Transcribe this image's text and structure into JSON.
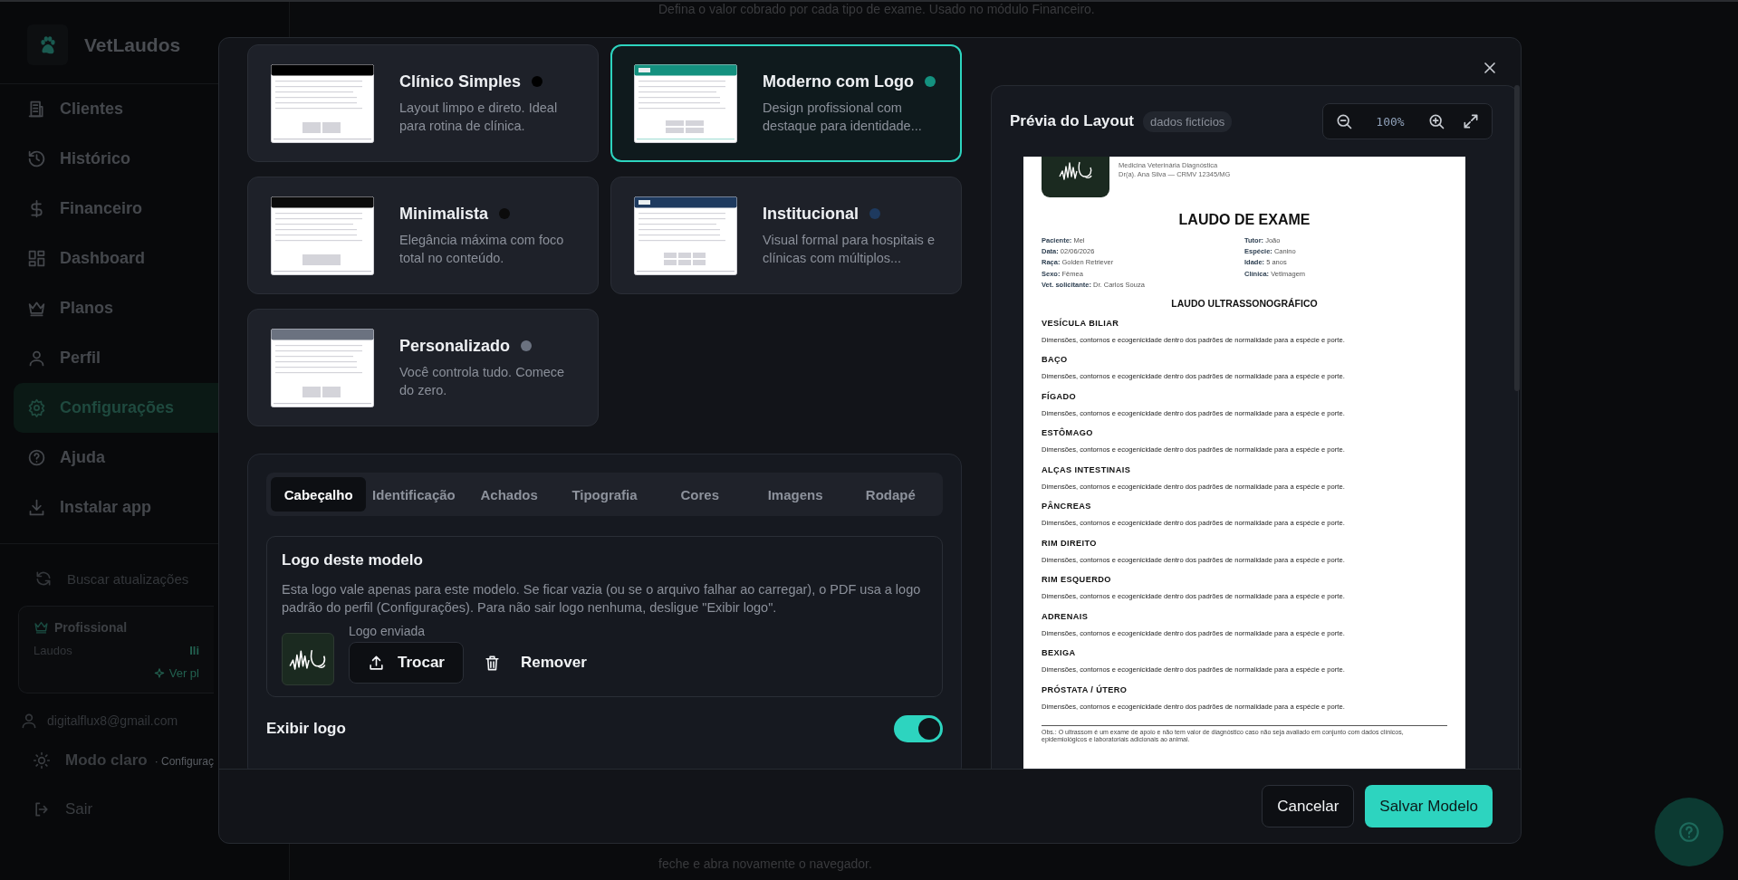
{
  "background": {
    "intro_text": "Defina o valor cobrado por cada tipo de exame. Usado no módulo Financeiro.",
    "footer_text": "feche e abra novamente o navegador."
  },
  "sidebar": {
    "brand": "VetLaudos",
    "items": [
      {
        "label": "Clientes",
        "selected": false
      },
      {
        "label": "Histórico",
        "selected": false
      },
      {
        "label": "Financeiro",
        "selected": false
      },
      {
        "label": "Dashboard",
        "selected": false
      },
      {
        "label": "Planos",
        "selected": false
      },
      {
        "label": "Perfil",
        "selected": false
      },
      {
        "label": "Configurações",
        "selected": true
      },
      {
        "label": "Ajuda",
        "selected": false
      },
      {
        "label": "Instalar app",
        "selected": false
      }
    ],
    "update_button": "Buscar atualizações",
    "plan": {
      "name": "Profissional",
      "usage_label": "Laudos",
      "usage_value": "Ili",
      "link": "Ver pl"
    },
    "email": "digitalflux8@gmail.com",
    "theme": {
      "label": "Modo claro",
      "hint": "· Configuraç"
    },
    "logout": "Sair"
  },
  "modal": {
    "templates": [
      {
        "name": "Clínico Simples",
        "description": "Layout limpo e direto. Ideal para rotina de clínica.",
        "color": "#000000",
        "kind": "simple",
        "selected": false
      },
      {
        "name": "Moderno com Logo",
        "description": "Design profissional com destaque para identidade...",
        "color": "#14917f",
        "kind": "modern",
        "selected": true
      },
      {
        "name": "Minimalista",
        "description": "Elegância máxima com foco total no conteúdo.",
        "color": "#0b0b0b",
        "kind": "minimal",
        "selected": false
      },
      {
        "name": "Institucional",
        "description": "Visual formal para hospitais e clínicas com múltiplos...",
        "color": "#1e3a5f",
        "kind": "institutional",
        "selected": false
      },
      {
        "name": "Personalizado",
        "description": "Você controla tudo. Comece do zero.",
        "color": "#6b7280",
        "kind": "custom",
        "selected": false
      }
    ],
    "editor": {
      "tabs": [
        {
          "label": "Cabeçalho",
          "selected": true
        },
        {
          "label": "Identificação",
          "selected": false
        },
        {
          "label": "Achados",
          "selected": false
        },
        {
          "label": "Tipografia",
          "selected": false
        },
        {
          "label": "Cores",
          "selected": false
        },
        {
          "label": "Imagens",
          "selected": false
        },
        {
          "label": "Rodapé",
          "selected": false
        }
      ],
      "logo_section": {
        "title": "Logo deste modelo",
        "description": "Esta logo vale apenas para este modelo. Se ficar vazia (ou se o arquivo falhar ao carregar), o PDF usa a logo padrão do perfil (Configurações). Para não sair logo nenhuma, desligue \"Exibir logo\".",
        "status": "Logo enviada",
        "replace_button": "Trocar",
        "remove_button": "Remover"
      },
      "show_logo": {
        "label": "Exibir logo",
        "on": true
      }
    },
    "preview": {
      "title": "Prévia do Layout",
      "badge": "dados fictícios",
      "zoom": "100%",
      "report": {
        "header_lines": [
          "Medicina Veterinária Diagnóstica",
          "Dr(a). Ana Silva — CRMV 12345/MG"
        ],
        "title": "LAUDO DE EXAME",
        "fields_left": [
          {
            "label": "Paciente:",
            "value": "Mel"
          },
          {
            "label": "Data:",
            "value": "02/06/2026"
          },
          {
            "label": "Raça:",
            "value": "Golden Retriever"
          },
          {
            "label": "Sexo:",
            "value": "Fêmea"
          },
          {
            "label": "Vet. solicitante:",
            "value": "Dr. Carlos Souza"
          }
        ],
        "fields_right": [
          {
            "label": "Tutor:",
            "value": "João"
          },
          {
            "label": "Espécie:",
            "value": "Canino"
          },
          {
            "label": "Idade:",
            "value": "5 anos"
          },
          {
            "label": "Clínica:",
            "value": "VetImagem"
          }
        ],
        "section_title": "LAUDO ULTRASSONOGRÁFICO",
        "findings": [
          {
            "organ": "VESÍCULA BILIAR",
            "text": "Dimensões, contornos e ecogenicidade dentro dos padrões de normalidade para a espécie e porte."
          },
          {
            "organ": "BAÇO",
            "text": "Dimensões, contornos e ecogenicidade dentro dos padrões de normalidade para a espécie e porte."
          },
          {
            "organ": "FÍGADO",
            "text": "Dimensões, contornos e ecogenicidade dentro dos padrões de normalidade para a espécie e porte."
          },
          {
            "organ": "ESTÔMAGO",
            "text": "Dimensões, contornos e ecogenicidade dentro dos padrões de normalidade para a espécie e porte."
          },
          {
            "organ": "ALÇAS INTESTINAIS",
            "text": "Dimensões, contornos e ecogenicidade dentro dos padrões de normalidade para a espécie e porte."
          },
          {
            "organ": "PÂNCREAS",
            "text": "Dimensões, contornos e ecogenicidade dentro dos padrões de normalidade para a espécie e porte."
          },
          {
            "organ": "RIM DIREITO",
            "text": "Dimensões, contornos e ecogenicidade dentro dos padrões de normalidade para a espécie e porte."
          },
          {
            "organ": "RIM ESQUERDO",
            "text": "Dimensões, contornos e ecogenicidade dentro dos padrões de normalidade para a espécie e porte."
          },
          {
            "organ": "ADRENAIS",
            "text": "Dimensões, contornos e ecogenicidade dentro dos padrões de normalidade para a espécie e porte."
          },
          {
            "organ": "BEXIGA",
            "text": "Dimensões, contornos e ecogenicidade dentro dos padrões de normalidade para a espécie e porte."
          },
          {
            "organ": "PRÓSTATA / ÚTERO",
            "text": "Dimensões, contornos e ecogenicidade dentro dos padrões de normalidade para a espécie e porte."
          }
        ],
        "note": "Obs.: O ultrassom é um exame de apoio e não tem valor de diagnóstico caso não seja avaliado em conjunto com dados clínicos, epidemiológicos e laboratoriais adicionais ao animal."
      }
    },
    "buttons": {
      "cancel": "Cancelar",
      "save": "Salvar Modelo"
    }
  }
}
